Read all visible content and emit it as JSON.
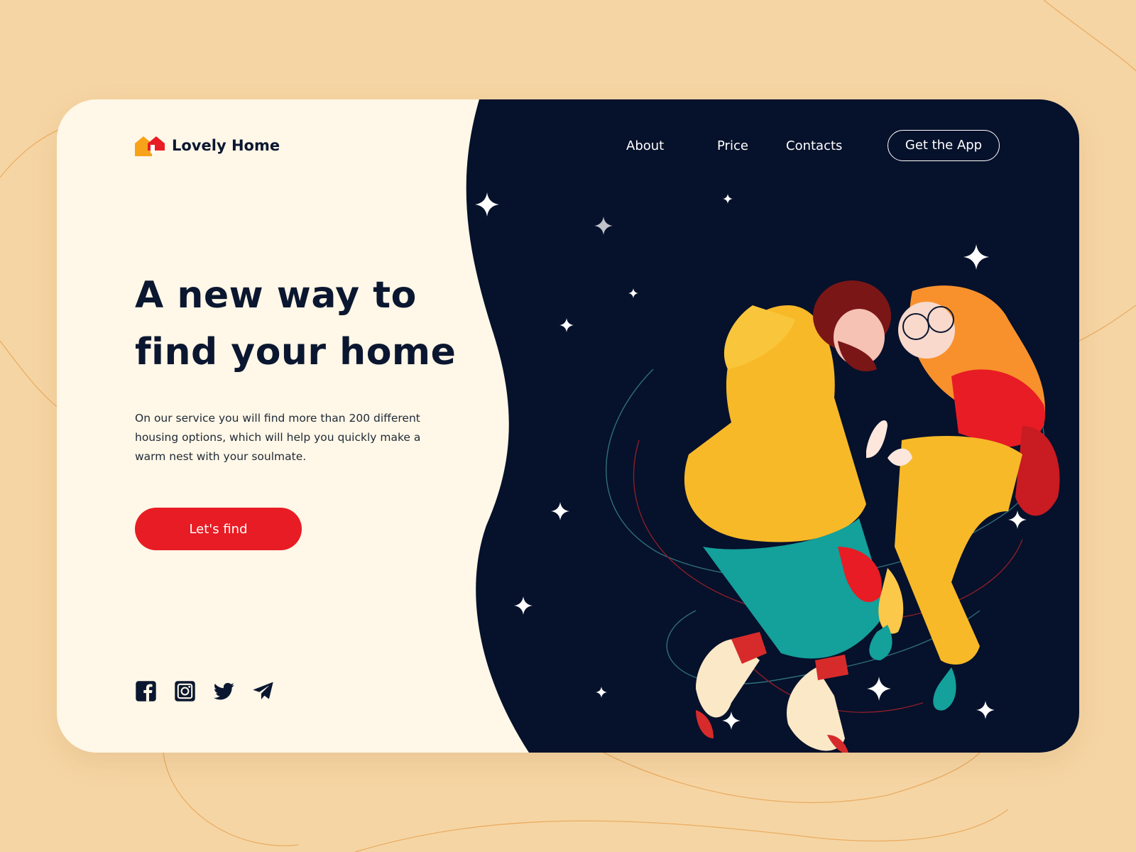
{
  "brand": {
    "name": "Lovely Home",
    "logo_icon": "house-icon"
  },
  "nav": {
    "links": [
      "About",
      "Price",
      "Contacts"
    ],
    "cta_label": "Get the App"
  },
  "hero": {
    "title": "A new way to find your home",
    "description": "On our service you will find more than 200 different housing options, which will help you quickly make a warm nest with your soulmate.",
    "button_label": "Let's find"
  },
  "social": [
    "facebook-icon",
    "instagram-icon",
    "twitter-icon",
    "telegram-icon"
  ],
  "illustration": {
    "subject": "couple-floating-illustration",
    "icons": [
      "sparkle-star-icon"
    ]
  },
  "colors": {
    "page_background": "#f6d5a4",
    "card_background": "#fff7e7",
    "dark_panel": "#06112b",
    "accent_red": "#e81c24",
    "heading_text": "#0b1730"
  }
}
